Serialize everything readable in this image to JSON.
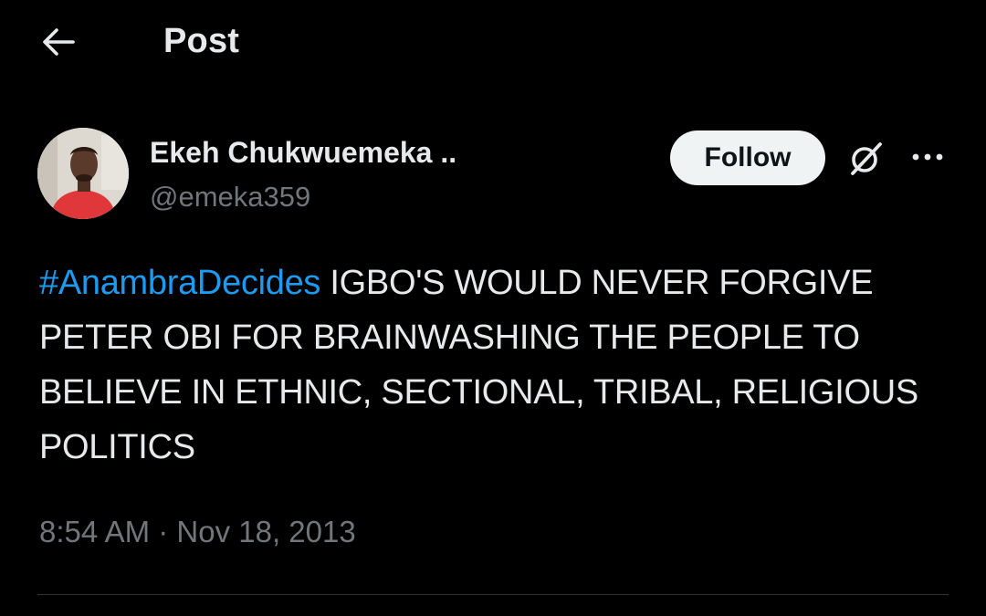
{
  "header": {
    "back_icon": "arrow-left-icon",
    "title": "Post"
  },
  "author": {
    "display_name": "Ekeh Chukwuemeka ..",
    "handle": "@emeka359",
    "avatar_icon": "profile-photo",
    "follow_label": "Follow",
    "grok_icon": "grok-icon",
    "more_icon": "more-horizontal-icon"
  },
  "tweet": {
    "hashtag": "#AnambraDecides",
    "body": " IGBO'S WOULD NEVER FORGIVE PETER OBI FOR BRAINWASHING THE PEOPLE TO BELIEVE IN ETHNIC, SECTIONAL, TRIBAL, RELIGIOUS POLITICS"
  },
  "meta": {
    "time": "8:54 AM",
    "separator": " · ",
    "date": "Nov 18, 2013"
  },
  "colors": {
    "background": "#000000",
    "text": "#e7e9ea",
    "muted": "#71767b",
    "link": "#1d9bf0",
    "button_bg": "#eff3f4",
    "divider": "#2f3336"
  }
}
